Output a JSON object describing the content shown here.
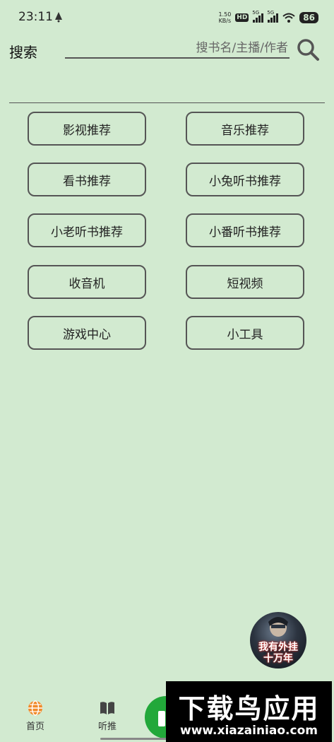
{
  "status_bar": {
    "time": "23:11",
    "net_speed_value": "1.50",
    "net_speed_unit": "KB/s",
    "hd_badge": "HD",
    "signal1_label": "5G",
    "signal2_label": "5G",
    "battery": "86"
  },
  "search": {
    "label": "搜索",
    "placeholder": "搜书名/主播/作者",
    "value": ""
  },
  "menu": {
    "items": [
      {
        "label": "影视推荐"
      },
      {
        "label": "音乐推荐"
      },
      {
        "label": "看书推荐"
      },
      {
        "label": "小兔听书推荐"
      },
      {
        "label": "小老听书推荐"
      },
      {
        "label": "小番听书推荐"
      },
      {
        "label": "收音机"
      },
      {
        "label": "短视频"
      },
      {
        "label": "游戏中心"
      },
      {
        "label": "小工具"
      }
    ]
  },
  "floating_cover": {
    "text_line1": "我有外挂",
    "text_line2": "十万年"
  },
  "bottom_nav": {
    "home_label": "首页",
    "listen_label": "听推"
  },
  "watermark": {
    "title": "下载鸟应用",
    "url": "www.xiazainiao.com"
  },
  "colors": {
    "background": "#d2ead0",
    "accent_green": "#22a83a",
    "border": "#555555"
  },
  "icons": {
    "search": "search-icon",
    "home": "globe-icon",
    "listen": "book-icon"
  }
}
